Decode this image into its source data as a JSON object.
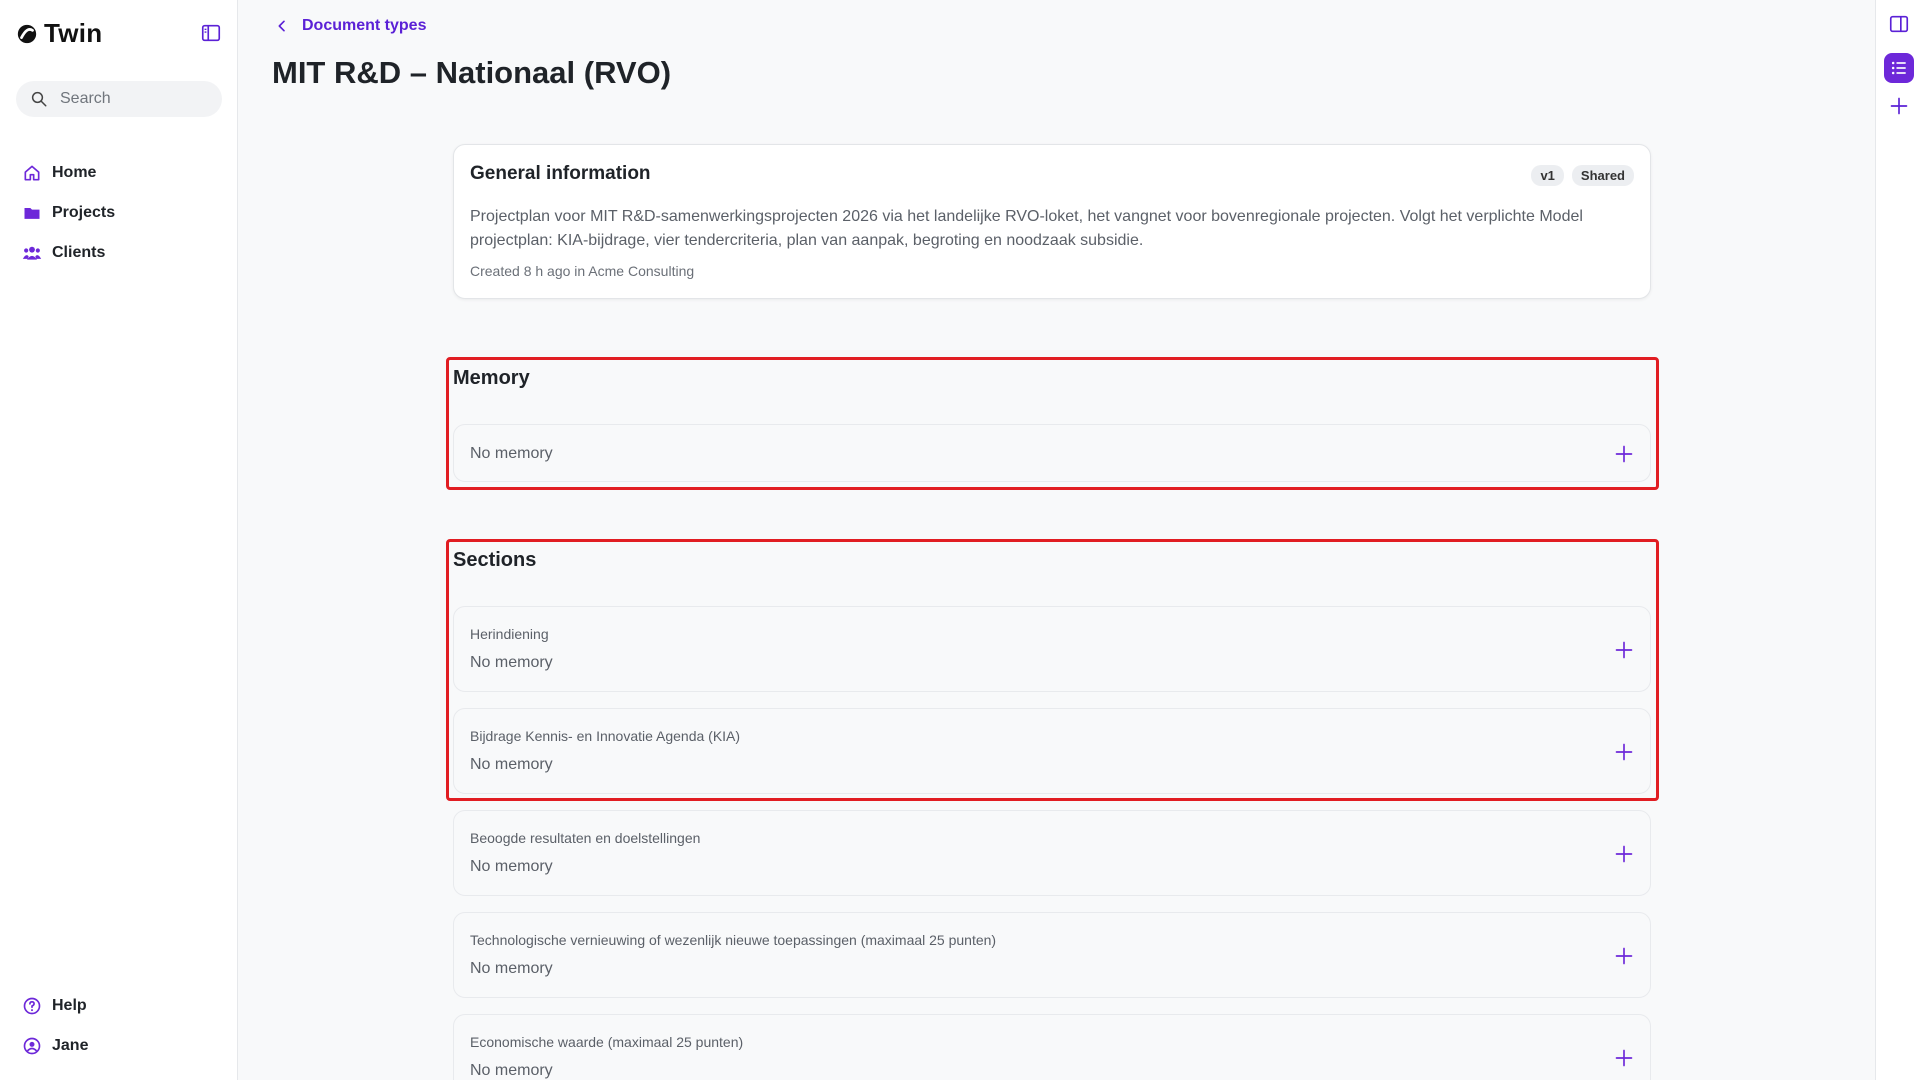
{
  "app": {
    "name": "Twin"
  },
  "search": {
    "placeholder": "Search"
  },
  "nav": {
    "home": "Home",
    "projects": "Projects",
    "clients": "Clients",
    "help": "Help",
    "user": "Jane"
  },
  "breadcrumb": {
    "label": "Document types"
  },
  "page": {
    "title": "MIT R&D – Nationaal (RVO)"
  },
  "general": {
    "title": "General information",
    "version": "v1",
    "shared": "Shared",
    "description": "Projectplan voor MIT R&D-samenwerkingsprojecten 2026 via het landelijke RVO-loket, het vangnet voor bovenregionale projecten. Volgt het verplichte Model projectplan: KIA-bijdrage, vier tendercriteria, plan van aanpak, begroting en noodzaak subsidie.",
    "meta": "Created 8 h ago in Acme Consulting"
  },
  "memory": {
    "title": "Memory",
    "value": "No memory"
  },
  "sections": {
    "title": "Sections",
    "items": [
      {
        "label": "Herindiening",
        "value": "No memory"
      },
      {
        "label": "Bijdrage Kennis- en Innovatie Agenda (KIA)",
        "value": "No memory"
      },
      {
        "label": "Beoogde resultaten en doelstellingen",
        "value": "No memory"
      },
      {
        "label": "Technologische vernieuwing of wezenlijk nieuwe toepassingen (maximaal 25 punten)",
        "value": "No memory"
      },
      {
        "label": "Economische waarde (maximaal 25 punten)",
        "value": "No memory"
      }
    ]
  },
  "colors": {
    "accent": "#6d28d9",
    "highlight": "#e11d22"
  },
  "icons": [
    "logo-icon",
    "sidebar-toggle-icon",
    "search-icon",
    "home-icon",
    "folder-icon",
    "users-icon",
    "help-icon",
    "user-icon",
    "chevron-left-icon",
    "plus-icon",
    "panel-icon",
    "list-icon"
  ]
}
